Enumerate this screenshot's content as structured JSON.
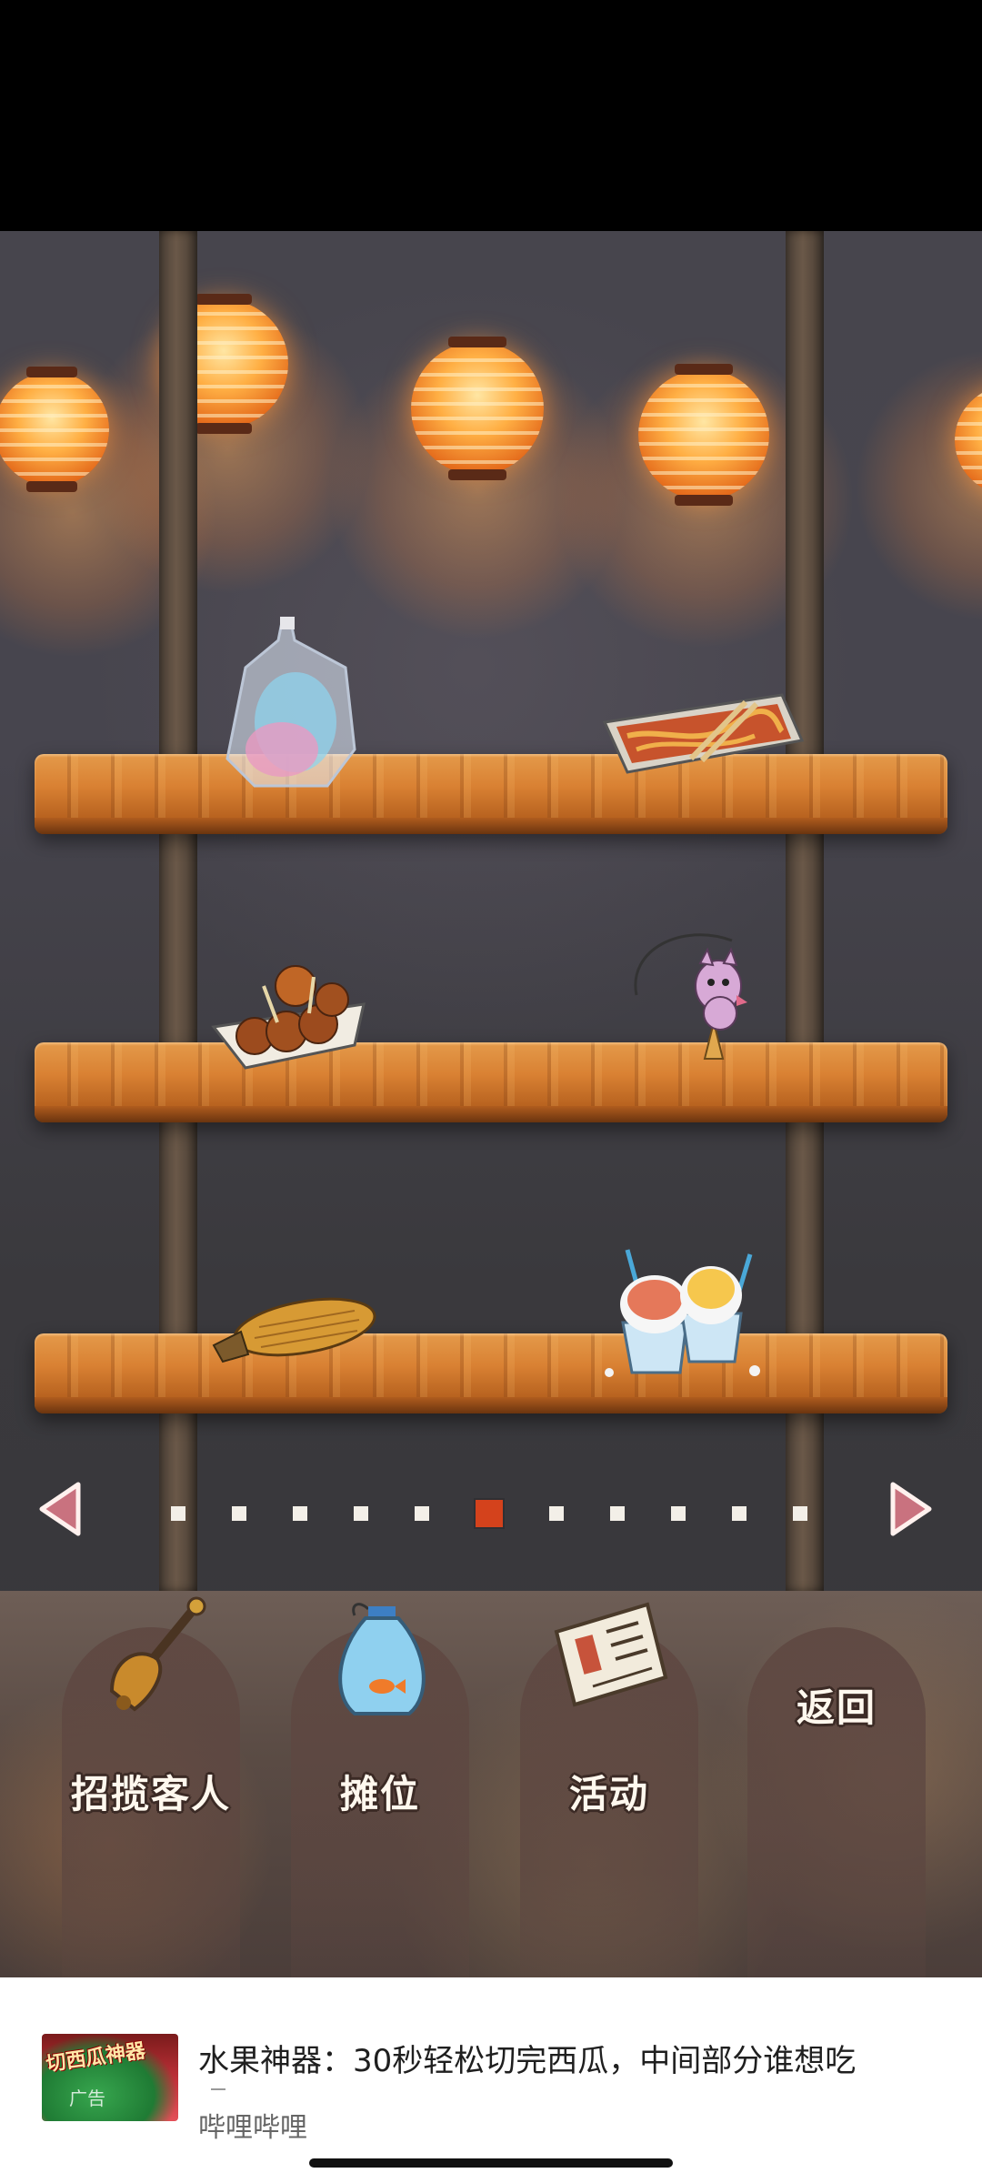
{
  "shelves": {
    "items": [
      {
        "name": "cotton-candy-bag-item",
        "shelf": 1,
        "side": "left"
      },
      {
        "name": "yakisoba-tray-item",
        "shelf": 1,
        "side": "right"
      },
      {
        "name": "takoyaki-boat-item",
        "shelf": 2,
        "side": "left"
      },
      {
        "name": "pink-mascot-charm-item",
        "shelf": 2,
        "side": "right"
      },
      {
        "name": "grilled-corn-item",
        "shelf": 3,
        "side": "left"
      },
      {
        "name": "shaved-ice-cups-item",
        "shelf": 3,
        "side": "right"
      }
    ]
  },
  "pagination": {
    "total_pages": 11,
    "current_page": 6,
    "prev_icon": "triangle-left-icon",
    "next_icon": "triangle-right-icon"
  },
  "menu": {
    "buttons": [
      {
        "label": "招揽客人",
        "icon": "bell-icon"
      },
      {
        "label": "摊位",
        "icon": "goldfish-bag-icon"
      },
      {
        "label": "活动",
        "icon": "newspaper-icon"
      },
      {
        "label": "返回",
        "icon": ""
      }
    ]
  },
  "ad": {
    "thumbnail_text": "切西瓜神器",
    "thumbnail_tag": "广告",
    "title": "水果神器：30秒轻松切完西瓜，中间部分谁想吃",
    "source": "哔哩哔哩"
  },
  "colors": {
    "shelf_wood": "#d98133",
    "active_dot": "#d4421c",
    "inactive_dot": "#f3efe8",
    "arrow_pink": "#c9727f",
    "lantern_orange": "#ffaf44"
  }
}
